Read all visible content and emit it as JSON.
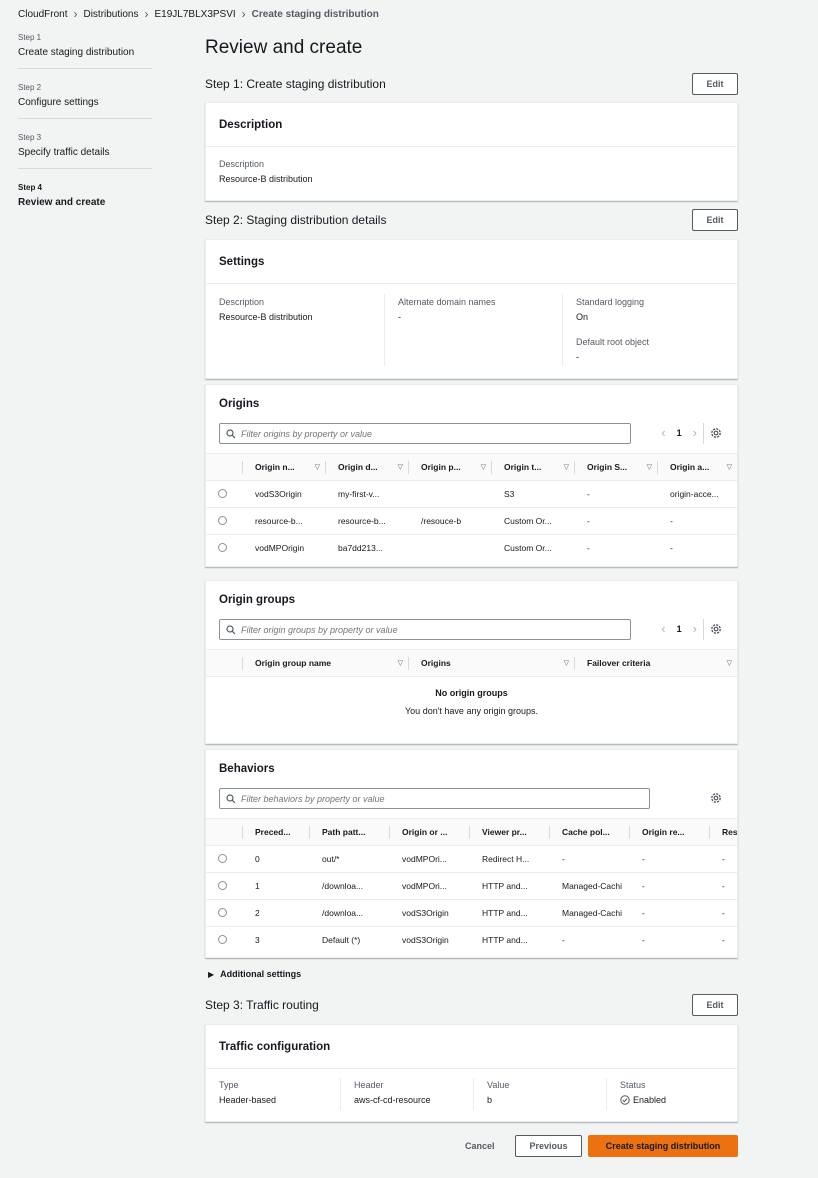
{
  "breadcrumb": {
    "items": [
      "CloudFront",
      "Distributions",
      "E19JL7BLX3PSVI"
    ],
    "current": "Create staging distribution"
  },
  "steps": [
    {
      "num": "Step 1",
      "label": "Create staging distribution"
    },
    {
      "num": "Step 2",
      "label": "Configure settings"
    },
    {
      "num": "Step 3",
      "label": "Specify traffic details"
    },
    {
      "num": "Step 4",
      "label": "Review and create"
    }
  ],
  "page_title": "Review and create",
  "edit_label": "Edit",
  "step1": {
    "title": "Step 1: Create staging distribution",
    "card_title": "Description",
    "label": "Description",
    "value": "Resource-B distribution"
  },
  "step2": {
    "title": "Step 2: Staging distribution details",
    "settings": {
      "card_title": "Settings",
      "description_label": "Description",
      "description_value": "Resource-B distribution",
      "alt_domains_label": "Alternate domain names",
      "alt_domains_value": "-",
      "logging_label": "Standard logging",
      "logging_value": "On",
      "root_label": "Default root object",
      "root_value": "-"
    },
    "origins": {
      "card_title": "Origins",
      "filter_placeholder": "Filter origins by property or value",
      "page": "1",
      "columns": [
        "Origin n...",
        "Origin d...",
        "Origin p...",
        "Origin t...",
        "Origin S...",
        "Origin a..."
      ],
      "rows": [
        [
          "vodS3Origin",
          "my-first-v...",
          "",
          "S3",
          "-",
          "origin-acce..."
        ],
        [
          "resource-b...",
          "resource-b...",
          "/resouce-b",
          "Custom Or...",
          "-",
          "-"
        ],
        [
          "vodMPOrigin",
          "ba7dd213...",
          "",
          "Custom Or...",
          "-",
          "-"
        ]
      ]
    },
    "origin_groups": {
      "card_title": "Origin groups",
      "filter_placeholder": "Filter origin groups by property or value",
      "page": "1",
      "columns": [
        "Origin group name",
        "Origins",
        "Failover criteria"
      ],
      "empty_title": "No origin groups",
      "empty_desc": "You don't have any origin groups."
    },
    "behaviors": {
      "card_title": "Behaviors",
      "filter_placeholder": "Filter behaviors by property or value",
      "columns": [
        "Preced...",
        "Path patt...",
        "Origin or ...",
        "Viewer pr...",
        "Cache pol...",
        "Origin re...",
        "Resp"
      ],
      "rows": [
        [
          "0",
          "out/*",
          "vodMPOri...",
          "Redirect H...",
          "-",
          "-",
          "-"
        ],
        [
          "1",
          "/downloa...",
          "vodMPOri...",
          "HTTP and...",
          "Managed-Cachi",
          "-",
          "-"
        ],
        [
          "2",
          "/downloa...",
          "vodS3Origin",
          "HTTP and...",
          "Managed-Cachi",
          "-",
          "-"
        ],
        [
          "3",
          "Default (*)",
          "vodS3Origin",
          "HTTP and...",
          "-",
          "-",
          "-"
        ]
      ]
    },
    "additional_settings": "Additional settings"
  },
  "step3": {
    "title": "Step 3: Traffic routing",
    "card_title": "Traffic configuration",
    "type_label": "Type",
    "type_value": "Header-based",
    "header_label": "Header",
    "header_value": "aws-cf-cd-resource",
    "value_label": "Value",
    "value_value": "b",
    "status_label": "Status",
    "status_value": "Enabled"
  },
  "footer": {
    "cancel": "Cancel",
    "previous": "Previous",
    "submit": "Create staging distribution"
  },
  "colors": {
    "background": "#f2f3f3",
    "primary_button": "#ec7211",
    "success": "#1d8102"
  }
}
